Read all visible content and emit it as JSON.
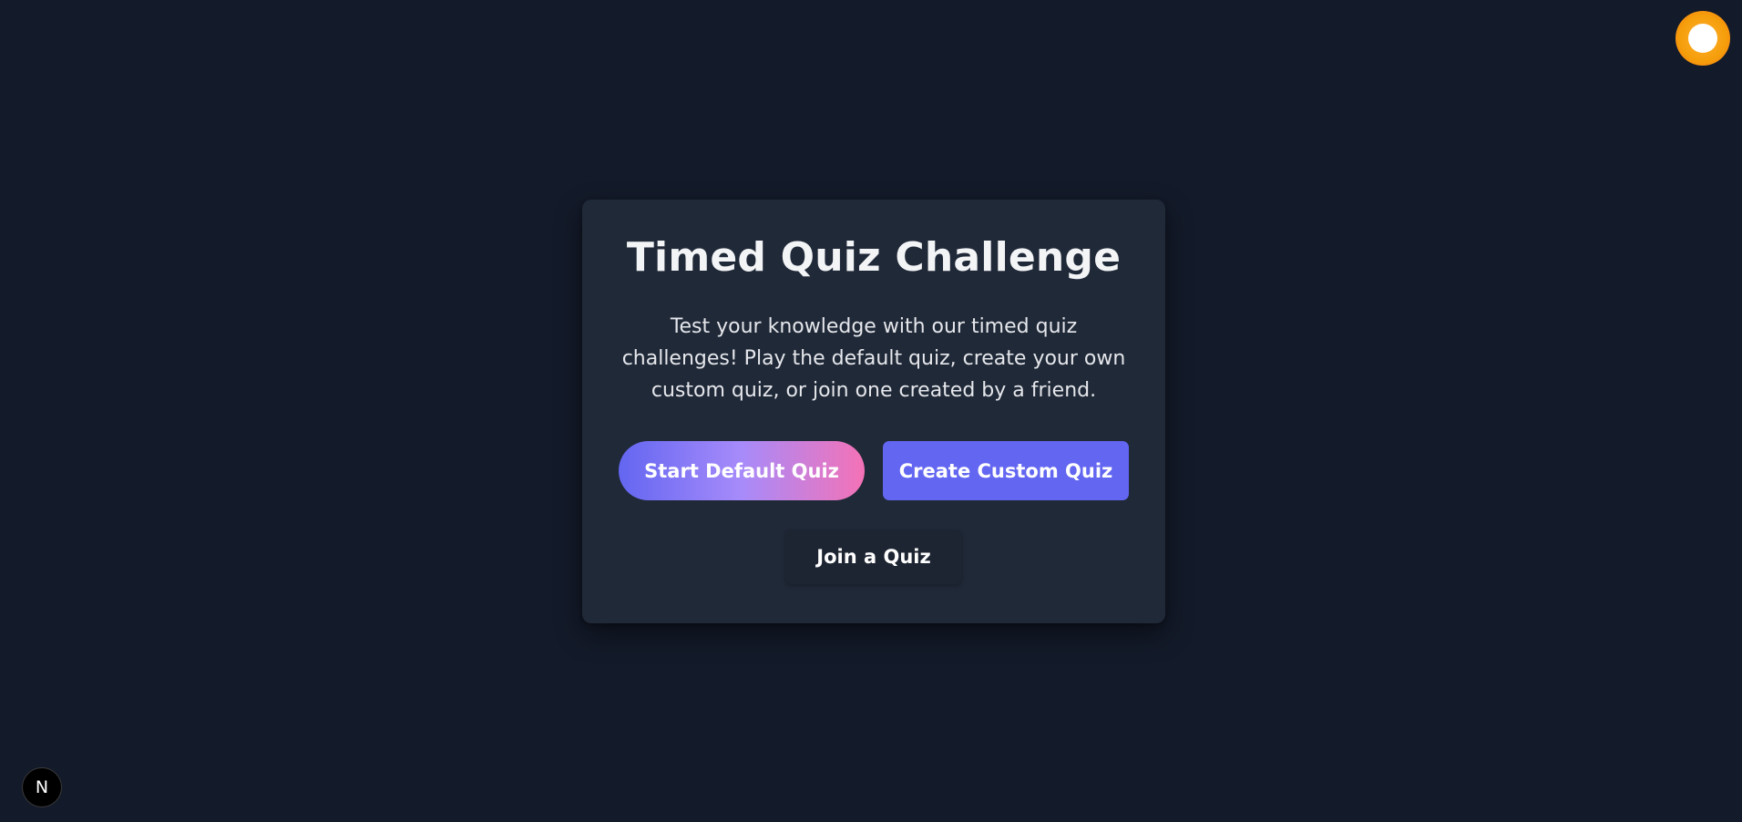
{
  "card": {
    "title": "Timed Quiz Challenge",
    "description": "Test your knowledge with our timed quiz challenges! Play the default quiz, create your own custom quiz, or join one created by a friend.",
    "buttons": {
      "start_default": "Start Default Quiz",
      "create_custom": "Create Custom Quiz",
      "join": "Join a Quiz"
    }
  },
  "corner_badge": {
    "label": "N",
    "icon": "nextjs-logo-icon"
  },
  "avatar": {
    "icon": "user-avatar-icon"
  },
  "colors": {
    "background": "#131a29",
    "card": "#202938",
    "primary": "#6366f1",
    "gradient_mid": "#a78bfa",
    "gradient_end": "#f472b6",
    "avatar": "#f59e0b"
  }
}
